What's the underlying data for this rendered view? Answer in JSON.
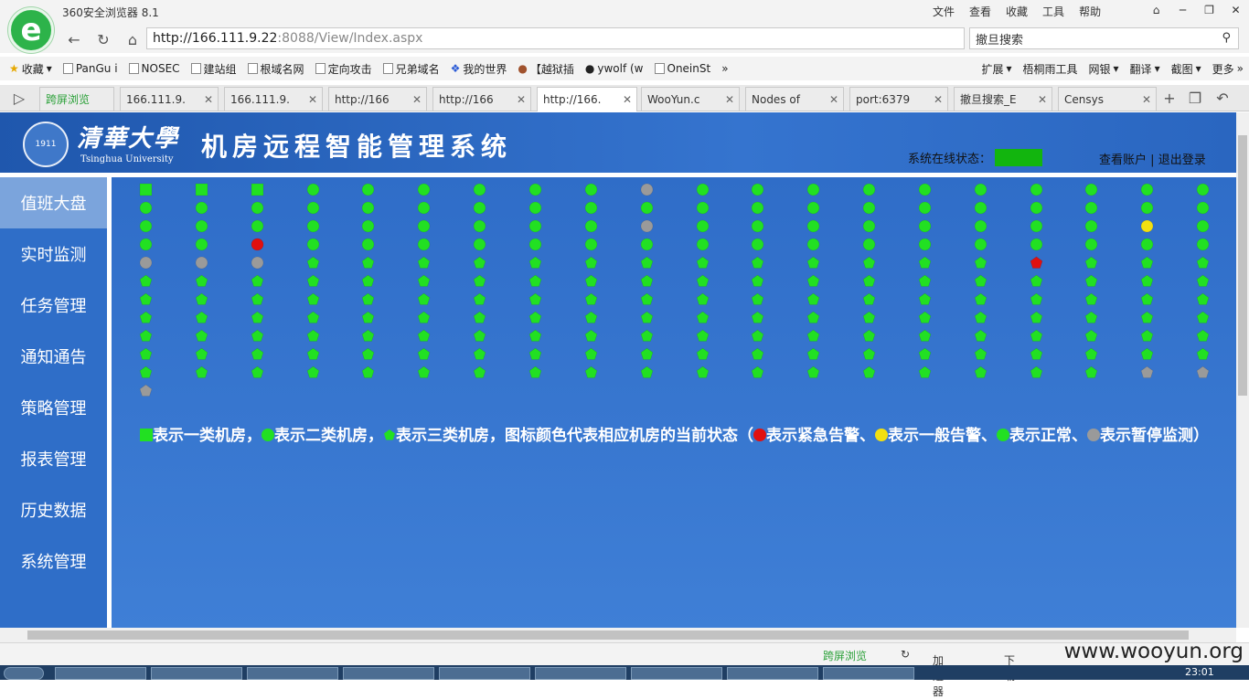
{
  "app_title": "360安全浏览器 8.1",
  "menu": [
    "文件",
    "查看",
    "收藏",
    "工具",
    "帮助"
  ],
  "url": {
    "host": "http://166.111.9.22",
    "rest": ":8088/View/Index.aspx"
  },
  "search_text": "撤旦搜索",
  "bookmarks": [
    "收藏",
    "PanGu i",
    "NOSEC",
    "建站组",
    "根域名网",
    "定向攻击",
    "兄弟域名",
    "我的世界",
    "【越狱插",
    "ywolf (w",
    "OneinSt"
  ],
  "bookmarks_right": [
    "扩展",
    "梧桐雨工具",
    "网银",
    "翻译",
    "截图",
    "更多"
  ],
  "tabs": [
    {
      "label": "跨屏浏览"
    },
    {
      "label": "166.111.9."
    },
    {
      "label": "166.111.9."
    },
    {
      "label": "http://166"
    },
    {
      "label": "http://166"
    },
    {
      "label": "http://166."
    },
    {
      "label": "WooYun.c"
    },
    {
      "label": "Nodes of"
    },
    {
      "label": "port:6379"
    },
    {
      "label": "撤旦搜索_E"
    },
    {
      "label": "Censys"
    }
  ],
  "header": {
    "university_cn": "清華大學",
    "university_en": "Tsinghua University",
    "seal_text": "1911",
    "system_title": "机房远程智能管理系统",
    "status_label": "系统在线状态：",
    "account_link": "查看账户",
    "logout_link": "退出登录",
    "sep": "|"
  },
  "sidebar": [
    {
      "label": "值班大盘"
    },
    {
      "label": "实时监测"
    },
    {
      "label": "任务管理"
    },
    {
      "label": "通知通告"
    },
    {
      "label": "策略管理"
    },
    {
      "label": "报表管理"
    },
    {
      "label": "历史数据"
    },
    {
      "label": "系统管理"
    }
  ],
  "legend": {
    "t1": "表示一类机房，",
    "t2": "表示二类机房，",
    "t3": "表示三类机房，图标颜色代表相应机房的当前状态（",
    "t4": "表示紧急告警、",
    "t5": "表示一般告警、",
    "t6": "表示正常、",
    "t7": "表示暂停监测）"
  },
  "status_colors": {
    "normal": "#22e022",
    "urgent": "#e01010",
    "general": "#f2e010",
    "paused": "#9a9a9a"
  },
  "room_grid": {
    "columns": 20,
    "rows": [
      [
        "square",
        "square",
        "square",
        "circle",
        "circle",
        "circle",
        "circle",
        "circle",
        "circle",
        "circle:gray",
        "circle",
        "circle",
        "circle",
        "circle",
        "circle",
        "circle",
        "circle",
        "circle",
        "circle",
        "circle"
      ],
      [
        "circle",
        "circle",
        "circle",
        "circle",
        "circle",
        "circle",
        "circle",
        "circle",
        "circle",
        "circle",
        "circle",
        "circle",
        "circle",
        "circle",
        "circle",
        "circle",
        "circle",
        "circle",
        "circle",
        "circle"
      ],
      [
        "circle",
        "circle",
        "circle",
        "circle",
        "circle",
        "circle",
        "circle",
        "circle",
        "circle",
        "circle:gray",
        "circle",
        "circle",
        "circle",
        "circle",
        "circle",
        "circle",
        "circle",
        "circle",
        "circle:yellow",
        "circle"
      ],
      [
        "circle",
        "circle",
        "circle:red",
        "circle",
        "circle",
        "circle",
        "circle",
        "circle",
        "circle",
        "circle",
        "circle",
        "circle",
        "circle",
        "circle",
        "circle",
        "circle",
        "circle",
        "circle",
        "circle",
        "circle"
      ],
      [
        "circle:gray",
        "circle:gray",
        "circle:gray",
        "pent",
        "pent",
        "pent",
        "pent",
        "pent",
        "pent",
        "pent",
        "pent",
        "pent",
        "pent",
        "pent",
        "pent",
        "pent",
        "pent:red",
        "pent",
        "pent",
        "pent"
      ],
      [
        "pent",
        "pent",
        "pent",
        "pent",
        "pent",
        "pent",
        "pent",
        "pent",
        "pent",
        "pent",
        "pent",
        "pent",
        "pent",
        "pent",
        "pent",
        "pent",
        "pent",
        "pent",
        "pent",
        "pent"
      ],
      [
        "pent",
        "pent",
        "pent",
        "pent",
        "pent",
        "pent",
        "pent",
        "pent",
        "pent",
        "pent",
        "pent",
        "pent",
        "pent",
        "pent",
        "pent",
        "pent",
        "pent",
        "pent",
        "pent",
        "pent"
      ],
      [
        "pent",
        "pent",
        "pent",
        "pent",
        "pent",
        "pent",
        "pent",
        "pent",
        "pent",
        "pent",
        "pent",
        "pent",
        "pent",
        "pent",
        "pent",
        "pent",
        "pent",
        "pent",
        "pent",
        "pent"
      ],
      [
        "pent",
        "pent",
        "pent",
        "pent",
        "pent",
        "pent",
        "pent",
        "pent",
        "pent",
        "pent",
        "pent",
        "pent",
        "pent",
        "pent",
        "pent",
        "pent",
        "pent",
        "pent",
        "pent",
        "pent"
      ],
      [
        "pent",
        "pent",
        "pent",
        "pent",
        "pent",
        "pent",
        "pent",
        "pent",
        "pent",
        "pent",
        "pent",
        "pent",
        "pent",
        "pent",
        "pent",
        "pent",
        "pent",
        "pent",
        "pent",
        "pent"
      ],
      [
        "pent",
        "pent",
        "pent",
        "pent",
        "pent",
        "pent",
        "pent",
        "pent",
        "pent",
        "pent",
        "pent",
        "pent",
        "pent",
        "pent",
        "pent",
        "pent",
        "pent",
        "pent",
        "pent:gray",
        "pent:gray"
      ],
      [
        "pent:gray"
      ]
    ]
  },
  "statusbar": {
    "cross_screen": "跨屏浏览",
    "accelerator": "加速器",
    "download": "下载"
  },
  "taskbar_time": "23:01",
  "watermark": "www.wooyun.org"
}
